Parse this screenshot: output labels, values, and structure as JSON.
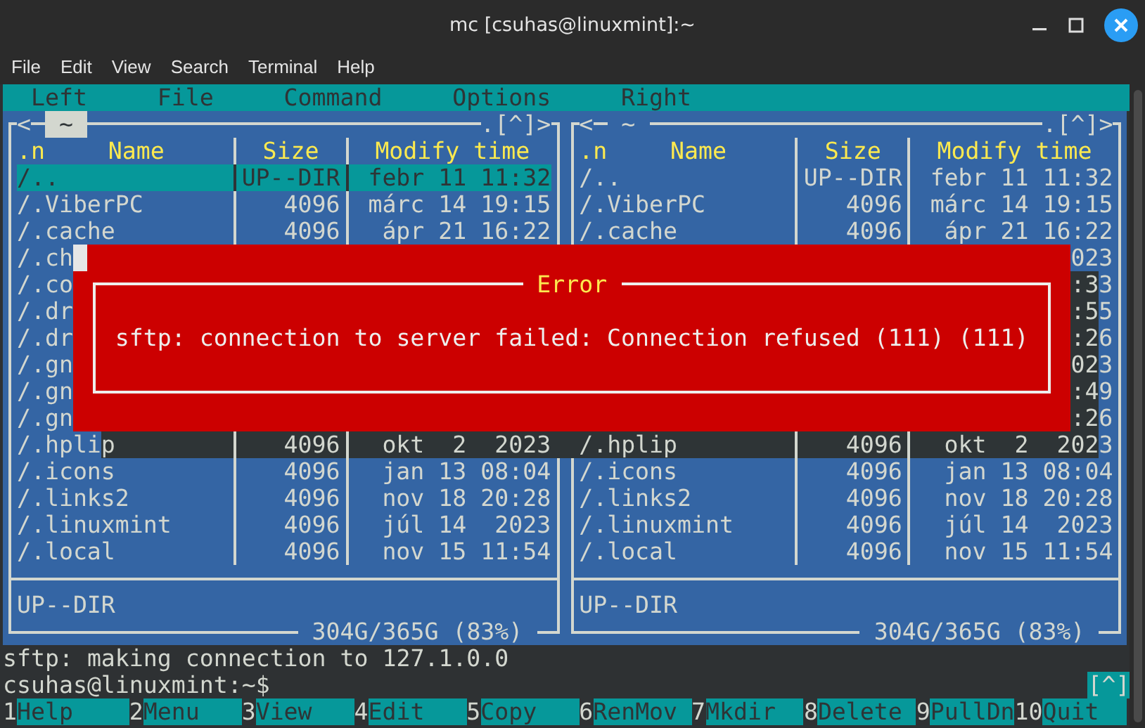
{
  "window": {
    "title": "mc [csuhas@linuxmint]:~"
  },
  "menu": [
    "File",
    "Edit",
    "View",
    "Search",
    "Terminal",
    "Help"
  ],
  "mc_menu": [
    "Left",
    "File",
    "Command",
    "Options",
    "Right"
  ],
  "panels": [
    {
      "active": true,
      "history": "<",
      "path": "~",
      "nav": ".[^]>",
      "sort_mark": ".n",
      "columns": [
        "Name",
        "Size",
        "Modify time"
      ],
      "rows": [
        {
          "name": "/..",
          "size": "UP--DIR",
          "time": "febr 11 11:32",
          "selected": true
        },
        {
          "name": "/.ViberPC",
          "size": "4096",
          "time": "márc 14 19:15",
          "selected": false
        },
        {
          "name": "/.cache",
          "size": "4096",
          "time": "ápr 21 16:22",
          "selected": false
        },
        {
          "name": "/.ch",
          "selected": false
        },
        {
          "name": "/.co",
          "selected": false
        },
        {
          "name": "/.dr",
          "selected": false
        },
        {
          "name": "/.dr",
          "selected": false
        },
        {
          "name": "/.gn",
          "selected": false
        },
        {
          "name": "/.gn",
          "selected": false
        },
        {
          "name": "/.gn",
          "selected": false
        },
        {
          "name": "/.hplip",
          "size": "4096",
          "time": "okt  2  2023",
          "selected": false
        },
        {
          "name": "/.icons",
          "size": "4096",
          "time": "jan 13 08:04",
          "selected": false
        },
        {
          "name": "/.links2",
          "size": "4096",
          "time": "nov 18 20:28",
          "selected": false
        },
        {
          "name": "/.linuxmint",
          "size": "4096",
          "time": "júl 14  2023",
          "selected": false
        },
        {
          "name": "/.local",
          "size": "4096",
          "time": "nov 15 11:54",
          "selected": false
        }
      ],
      "mini_status": "UP--DIR",
      "disk": "304G/365G (83%)"
    },
    {
      "active": false,
      "history": "<",
      "path": "~",
      "nav": ".[^]>",
      "sort_mark": ".n",
      "columns": [
        "Name",
        "Size",
        "Modify time"
      ],
      "rows": [
        {
          "name": "/..",
          "size": "UP--DIR",
          "time": "febr 11 11:32",
          "selected": false
        },
        {
          "name": "/.ViberPC",
          "size": "4096",
          "time": "márc 14 19:15",
          "selected": false
        },
        {
          "name": "/.cache",
          "size": "4096",
          "time": "ápr 21 16:22",
          "selected": false
        },
        {
          "time": "023",
          "selected": false
        },
        {
          "time": ":33",
          "selected": false
        },
        {
          "time": ":55",
          "selected": false
        },
        {
          "time": ":26",
          "selected": false
        },
        {
          "time": "023",
          "selected": false
        },
        {
          "time": ":49",
          "selected": false
        },
        {
          "time": ":26",
          "selected": false
        },
        {
          "name": "/.hplip",
          "size": "4096",
          "time": "okt  2  2023",
          "selected": false
        },
        {
          "name": "/.icons",
          "size": "4096",
          "time": "jan 13 08:04",
          "selected": false
        },
        {
          "name": "/.links2",
          "size": "4096",
          "time": "nov 18 20:28",
          "selected": false
        },
        {
          "name": "/.linuxmint",
          "size": "4096",
          "time": "júl 14  2023",
          "selected": false
        },
        {
          "name": "/.local",
          "size": "4096",
          "time": "nov 15 11:54",
          "selected": false
        }
      ],
      "mini_status": "UP--DIR",
      "disk": "304G/365G (83%)"
    }
  ],
  "output": [
    "sftp: making connection to 127.1.0.0"
  ],
  "prompt": "csuhas@linuxmint:~$",
  "subshell_button": "[^]",
  "fkeys": [
    {
      "num": "1",
      "label": "Help"
    },
    {
      "num": "2",
      "label": "Menu"
    },
    {
      "num": "3",
      "label": "View"
    },
    {
      "num": "4",
      "label": "Edit"
    },
    {
      "num": "5",
      "label": "Copy"
    },
    {
      "num": "6",
      "label": "RenMov"
    },
    {
      "num": "7",
      "label": "Mkdir"
    },
    {
      "num": "8",
      "label": "Delete"
    },
    {
      "num": "9",
      "label": "PullDn"
    },
    {
      "num": "10",
      "label": "Quit"
    }
  ],
  "dialog": {
    "title": "Error",
    "message": "sftp: connection to server failed: Connection refused (111) (111)"
  }
}
